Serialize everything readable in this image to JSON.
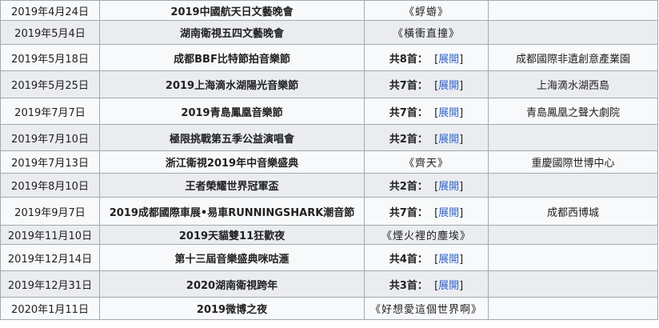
{
  "rows": [
    {
      "date": "2019年4月24日",
      "event": "2019中國航天日文藝晚會",
      "songs_count": "",
      "songs_song": "《蜉蝣》",
      "venue": ""
    },
    {
      "date": "2019年5月4日",
      "event": "湖南衛視五四文藝晚會",
      "songs_count": "",
      "songs_song": "《橫衝直撞》",
      "venue": ""
    },
    {
      "date": "2019年5月18日",
      "event": "成都BBF比特節拍音樂節",
      "songs_count": "共8首：",
      "songs_song": "",
      "venue": "成都國際非遺創意產業園"
    },
    {
      "date": "2019年5月25日",
      "event": "2019上海滴水湖陽光音樂節",
      "songs_count": "共7首：",
      "songs_song": "",
      "venue": "上海滴水湖西島"
    },
    {
      "date": "2019年7月7日",
      "event": "2019青島鳳凰音樂節",
      "songs_count": "共7首：",
      "songs_song": "",
      "venue": "青島鳳凰之聲大劇院"
    },
    {
      "date": "2019年7月10日",
      "event": "極限挑戰第五季公益演唱會",
      "songs_count": "共2首：",
      "songs_song": "",
      "venue": ""
    },
    {
      "date": "2019年7月13日",
      "event": "浙江衛視2019年中音樂盛典",
      "songs_count": "",
      "songs_song": "《齊天》",
      "venue": "重慶國際世博中心"
    },
    {
      "date": "2019年8月10日",
      "event": "王者榮耀世界冠軍盃",
      "songs_count": "共2首：",
      "songs_song": "",
      "venue": ""
    },
    {
      "date": "2019年9月7日",
      "event": "2019成都國際車展•易車RUNNINGSHARK潮音節",
      "songs_count": "共7首：",
      "songs_song": "",
      "venue": "成都西博城"
    },
    {
      "date": "2019年11月10日",
      "event": "2019天貓雙11狂歡夜",
      "songs_count": "",
      "songs_song": "《煙火裡的塵埃》",
      "venue": ""
    },
    {
      "date": "2019年12月14日",
      "event": "第十三屆音樂盛典咪咕滙",
      "songs_count": "共4首：",
      "songs_song": "",
      "venue": ""
    },
    {
      "date": "2019年12月31日",
      "event": "2020湖南衛視跨年",
      "songs_count": "共3首：",
      "songs_song": "",
      "venue": ""
    },
    {
      "date": "2020年1月11日",
      "event": "2019微博之夜",
      "songs_count": "",
      "songs_song": "《好想愛這個世界啊》",
      "venue": ""
    }
  ],
  "toggle": {
    "open_bracket": "[",
    "label": "展開",
    "close_bracket": "]"
  },
  "colors": {
    "border": "#a2a9b1",
    "row_light": "#f8f9fa",
    "row_dark": "#eaecf0",
    "link": "#3366cc",
    "text": "#202122"
  }
}
